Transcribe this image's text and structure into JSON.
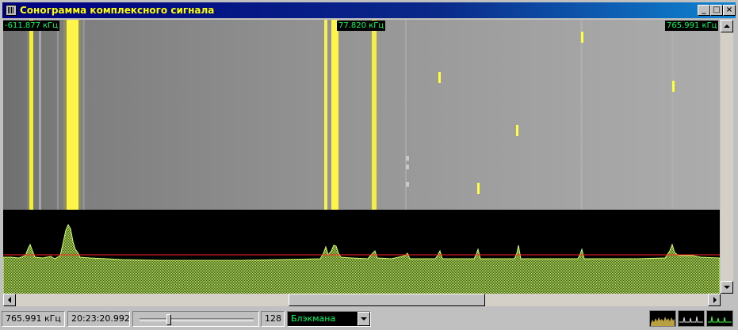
{
  "window": {
    "title": "Сонограмма комплексного сигнала",
    "buttons": [
      "_",
      "□",
      "×"
    ]
  },
  "frequency_markers": {
    "left": "-611.877 кГц",
    "center": "77.820 кГц",
    "right": "765.991 кГц"
  },
  "status": {
    "frequency": "765.991 кГц",
    "time": "20:23:20.992",
    "fft_size": "128",
    "window_function": "Блэкмана"
  },
  "colors": {
    "signal": "#ffff40",
    "marker_text": "#00ff60",
    "spectrum_fill": "#b8e860",
    "threshold_line": "#ff2020"
  }
}
